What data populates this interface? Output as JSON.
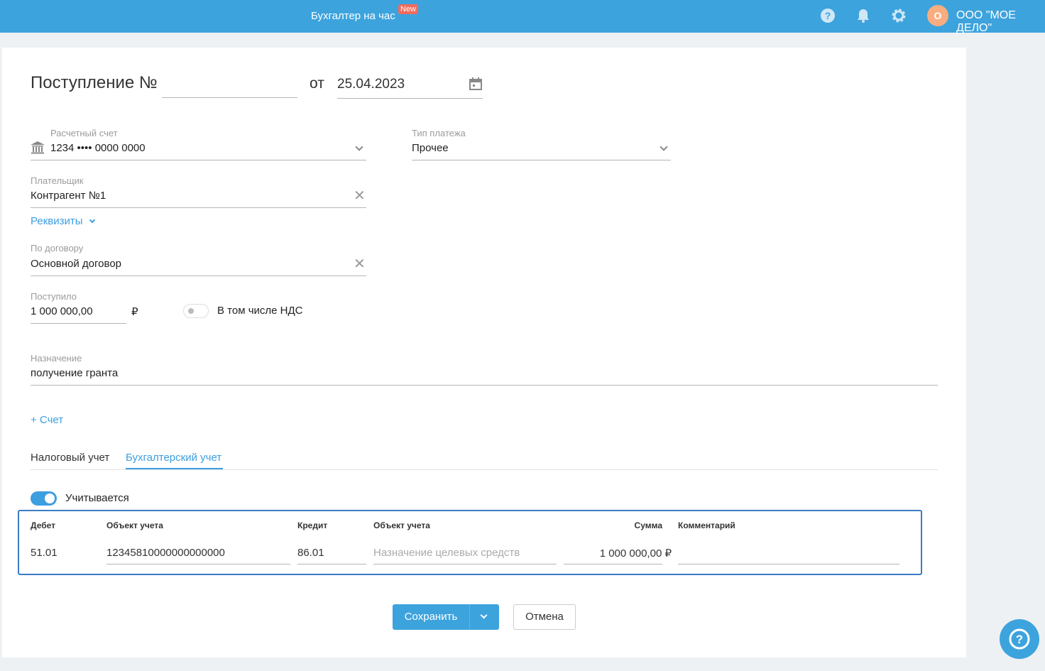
{
  "header": {
    "service": "Бухгалтер на час",
    "new_badge": "New",
    "avatar_letter": "О",
    "company": "ООО \"МОЕ ДЕЛО\""
  },
  "doc": {
    "title": "Поступление №",
    "number": "",
    "from_label": "от",
    "date": "25.04.2023"
  },
  "account": {
    "label": "Расчетный счет",
    "value": "1234 •••• 0000 0000"
  },
  "payment_type": {
    "label": "Тип платежа",
    "value": "Прочее"
  },
  "payer": {
    "label": "Плательщик",
    "value": "Контрагент №1"
  },
  "details_link": "Реквизиты",
  "contract": {
    "label": "По договору",
    "value": "Основной договор"
  },
  "received": {
    "label": "Поступило",
    "value": "1 000 000,00",
    "currency": "₽"
  },
  "vat": {
    "label": "В том числе НДС",
    "enabled": false
  },
  "purpose": {
    "label": "Назначение",
    "value": "получение гранта"
  },
  "add_invoice": "+ Счет",
  "tabs": [
    {
      "label": "Налоговый учет",
      "active": false
    },
    {
      "label": "Бухгалтерский учет",
      "active": true
    }
  ],
  "accounted": {
    "label": "Учитывается",
    "enabled": true
  },
  "table": {
    "headers": [
      "Дебет",
      "Объект учета",
      "Кредит",
      "Объект учета",
      "Сумма",
      "Комментарий"
    ],
    "row": {
      "debit": "51.01",
      "debit_object": "12345810000000000000",
      "credit": "86.01",
      "credit_object_placeholder": "Назначение целевых средств",
      "sum": "1 000 000,00 ₽",
      "comment": ""
    }
  },
  "buttons": {
    "save": "Сохранить",
    "cancel": "Отмена"
  }
}
